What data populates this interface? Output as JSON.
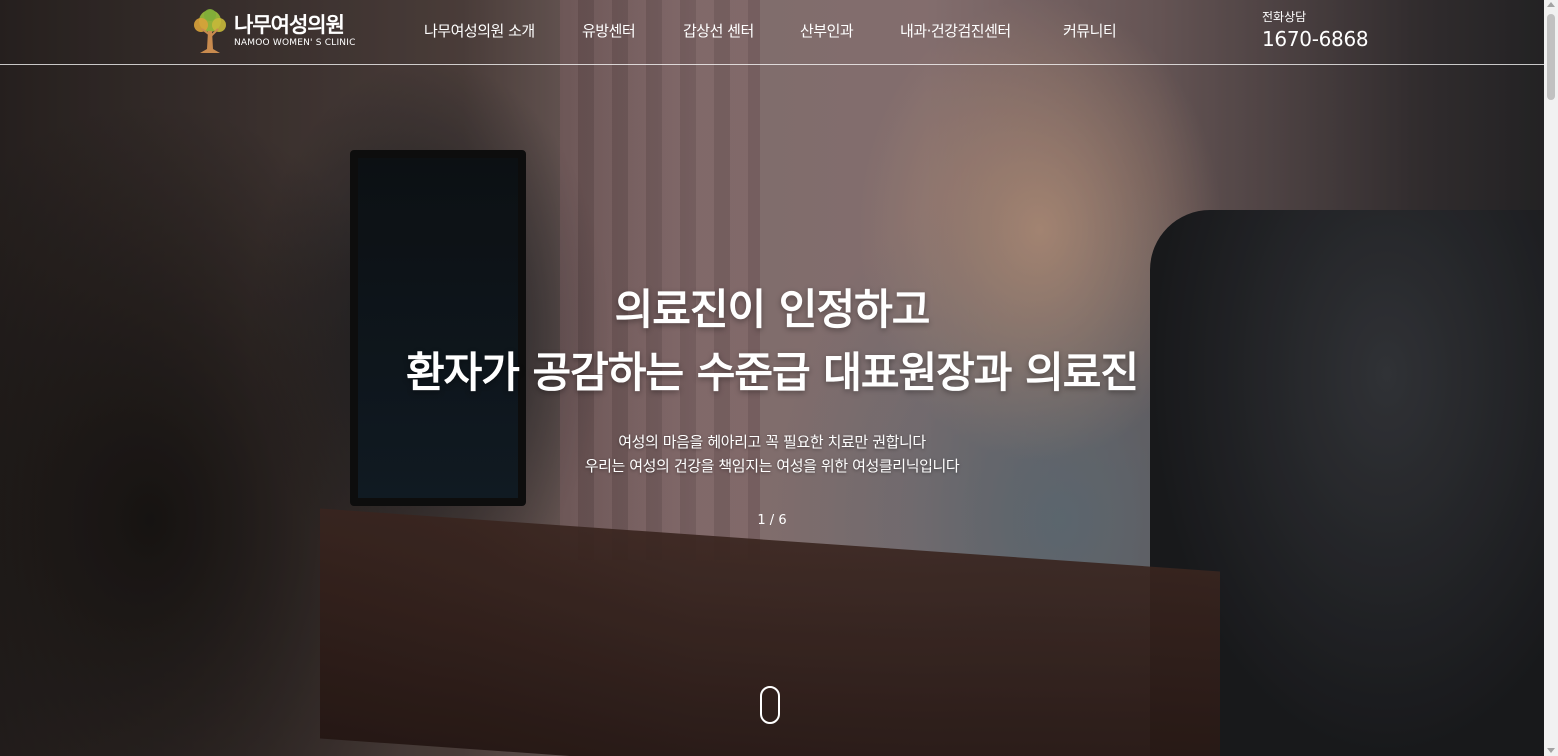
{
  "header": {
    "logo": {
      "name_ko": "나무여성의원",
      "name_en": "NAMOO WOMEN' S CLINIC",
      "icon": "tree-logo-icon"
    },
    "nav": [
      "나무여성의원 소개",
      "유방센터",
      "갑상선 센터",
      "산부인과",
      "내과·건강검진센터",
      "커뮤니티"
    ],
    "phone": {
      "label": "전화상담",
      "number": "1670-6868"
    }
  },
  "hero": {
    "headline_line1": "의료진이 인정하고",
    "headline_line2": "환자가 공감하는 수준급 대표원장과 의료진",
    "sub_line1": "여성의 마음을 헤아리고 꼭 필요한 치료만 권합니다",
    "sub_line2": "우리는 여성의 건강을 책임지는 여성을 위한 여성클리닉입니다",
    "pager": "1 / 6",
    "scroll_icon": "mouse-scroll-icon"
  },
  "colors": {
    "text": "#ffffff",
    "logo_leaf_green": "#9bbf3b",
    "logo_leaf_gold": "#d8a23a",
    "logo_trunk": "#c98b4e"
  }
}
